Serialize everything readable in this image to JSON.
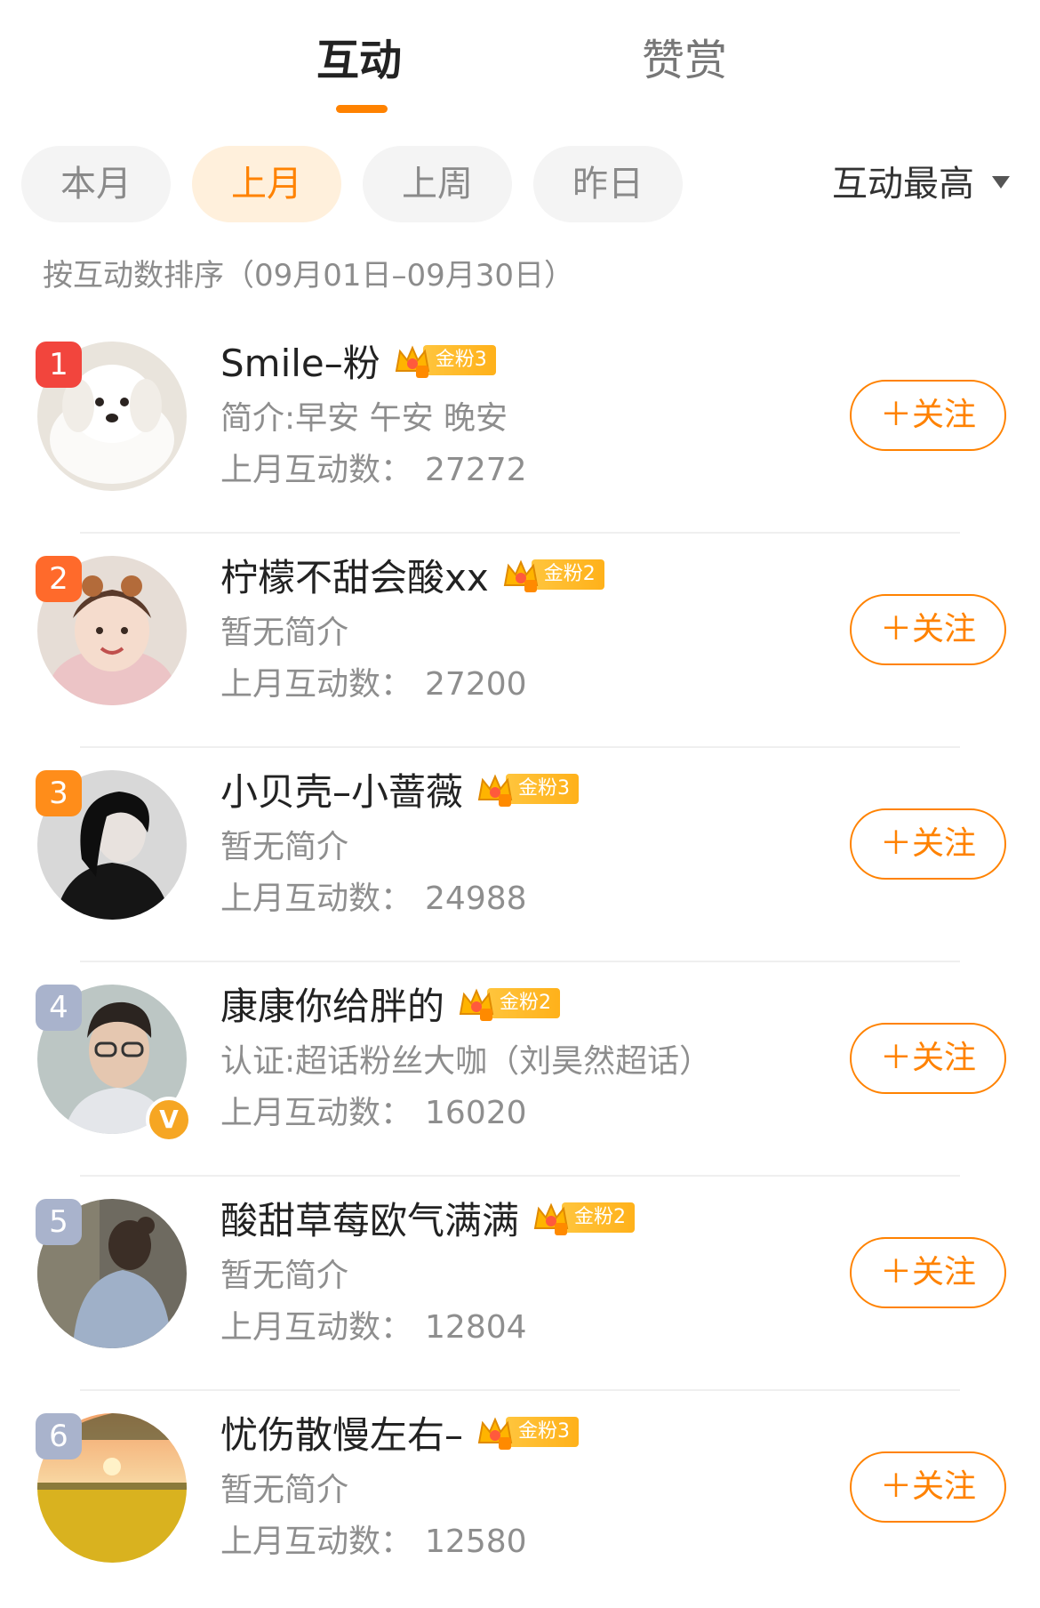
{
  "tabs": [
    {
      "label": "互动",
      "active": true
    },
    {
      "label": "赞赏",
      "active": false
    }
  ],
  "colors": {
    "accent": "#ff8200",
    "chip_active_bg": "#fff0dc",
    "rank_1": "#f2453d",
    "rank_2": "#ff6a2b",
    "rank_3": "#ff8d1a",
    "rank_other": "#a9b3cc"
  },
  "filters": {
    "periods": [
      "本月",
      "上月",
      "上周",
      "昨日"
    ],
    "selected": "上月",
    "sort_label": "互动最高",
    "sort_icon": "caret-down-icon"
  },
  "sort_hint": "按互动数排序（09月01日–09月30日）",
  "users": [
    {
      "rank": "1",
      "name": "Smile–粉",
      "fan_level": "金粉3",
      "bio": "简介:早安 午安 晚安",
      "count_label": "上月互动数：",
      "count": "27272",
      "follow_label": "＋关注",
      "verified": false
    },
    {
      "rank": "2",
      "name": "柠檬不甜会酸xx",
      "fan_level": "金粉2",
      "bio": "暂无简介",
      "count_label": "上月互动数：",
      "count": "27200",
      "follow_label": "＋关注",
      "verified": false
    },
    {
      "rank": "3",
      "name": "小贝壳–小蔷薇",
      "fan_level": "金粉3",
      "bio": "暂无简介",
      "count_label": "上月互动数：",
      "count": "24988",
      "follow_label": "＋关注",
      "verified": false
    },
    {
      "rank": "4",
      "name": "康康你给胖的",
      "fan_level": "金粉2",
      "bio": "认证:超话粉丝大咖（刘昊然超话）",
      "count_label": "上月互动数：",
      "count": "16020",
      "follow_label": "＋关注",
      "verified": true,
      "verified_mark": "V"
    },
    {
      "rank": "5",
      "name": "酸甜草莓欧气满满",
      "fan_level": "金粉2",
      "bio": "暂无简介",
      "count_label": "上月互动数：",
      "count": "12804",
      "follow_label": "＋关注",
      "verified": false
    },
    {
      "rank": "6",
      "name": "忧伤散慢左右–",
      "fan_level": "金粉3",
      "bio": "暂无简介",
      "count_label": "上月互动数：",
      "count": "12580",
      "follow_label": "＋关注",
      "verified": false
    }
  ]
}
